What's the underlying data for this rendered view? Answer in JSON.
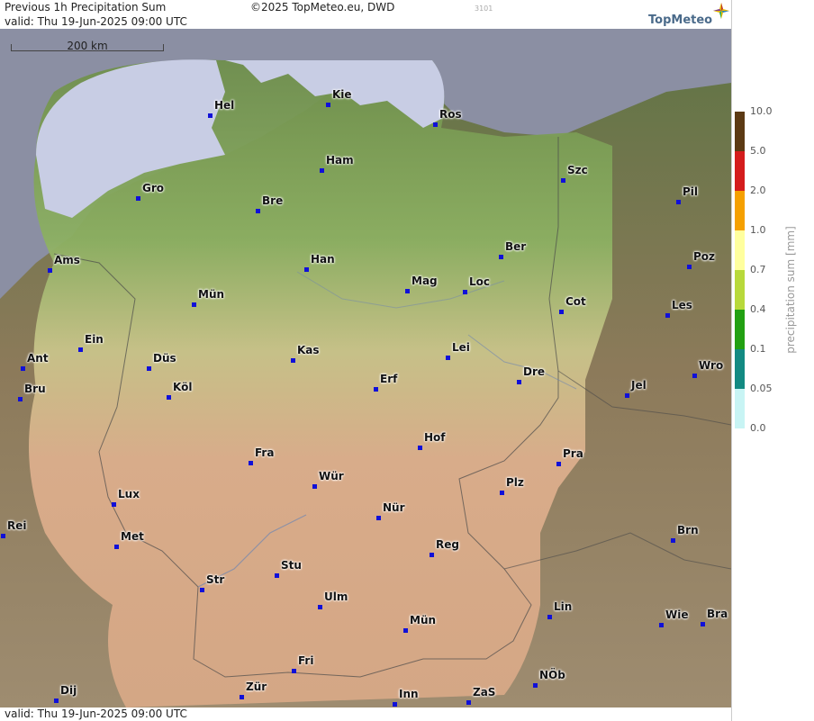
{
  "header": {
    "title": "Previous 1h Precipitation Sum",
    "valid": "valid:  Thu  19-Jun-2025 09:00 UTC",
    "copyright": "©2025 TopMeteo.eu, DWD",
    "run_id": "3101",
    "logo": "TopMeteo"
  },
  "footer": {
    "valid": "valid:  Thu  19-Jun-2025 09:00 UTC"
  },
  "map": {
    "scale_label": "200 km",
    "colors": {
      "sea": "#c8cde4",
      "outside_sea": "#8b8fa3",
      "lowland": "#7aa35a",
      "upland": "#e2b69a"
    },
    "cities": [
      {
        "id": "hel",
        "name": "Hel"
      },
      {
        "id": "kie",
        "name": "Kie"
      },
      {
        "id": "ros",
        "name": "Ros"
      },
      {
        "id": "ham",
        "name": "Ham"
      },
      {
        "id": "szc",
        "name": "Szc"
      },
      {
        "id": "gro",
        "name": "Gro"
      },
      {
        "id": "bre",
        "name": "Bre"
      },
      {
        "id": "pil",
        "name": "Pil"
      },
      {
        "id": "ber",
        "name": "Ber"
      },
      {
        "id": "ams",
        "name": "Ams"
      },
      {
        "id": "han",
        "name": "Han"
      },
      {
        "id": "poz",
        "name": "Poz"
      },
      {
        "id": "mag",
        "name": "Mag"
      },
      {
        "id": "loc",
        "name": "Loc"
      },
      {
        "id": "mun",
        "name": "Mün"
      },
      {
        "id": "cot",
        "name": "Cot"
      },
      {
        "id": "les",
        "name": "Les"
      },
      {
        "id": "ein",
        "name": "Ein"
      },
      {
        "id": "kas",
        "name": "Kas"
      },
      {
        "id": "lei",
        "name": "Lei"
      },
      {
        "id": "ant",
        "name": "Ant"
      },
      {
        "id": "dus",
        "name": "Düs"
      },
      {
        "id": "wro",
        "name": "Wro"
      },
      {
        "id": "dre",
        "name": "Dre"
      },
      {
        "id": "erf",
        "name": "Erf"
      },
      {
        "id": "bru",
        "name": "Bru"
      },
      {
        "id": "kol",
        "name": "Köl"
      },
      {
        "id": "jel",
        "name": "Jel"
      },
      {
        "id": "hof",
        "name": "Hof"
      },
      {
        "id": "fra",
        "name": "Fra"
      },
      {
        "id": "pra",
        "name": "Pra"
      },
      {
        "id": "wur",
        "name": "Wür"
      },
      {
        "id": "plz",
        "name": "Plz"
      },
      {
        "id": "lux",
        "name": "Lux"
      },
      {
        "id": "nur",
        "name": "Nür"
      },
      {
        "id": "rei",
        "name": "Rei"
      },
      {
        "id": "brn",
        "name": "Brn"
      },
      {
        "id": "met",
        "name": "Met"
      },
      {
        "id": "reg",
        "name": "Reg"
      },
      {
        "id": "stu",
        "name": "Stu"
      },
      {
        "id": "str",
        "name": "Str"
      },
      {
        "id": "ulm",
        "name": "Ulm"
      },
      {
        "id": "lin",
        "name": "Lin"
      },
      {
        "id": "wie",
        "name": "Wie"
      },
      {
        "id": "bra",
        "name": "Bra"
      },
      {
        "id": "mue",
        "name": "Mün"
      },
      {
        "id": "fri",
        "name": "Fri"
      },
      {
        "id": "nob",
        "name": "NÖb"
      },
      {
        "id": "dij",
        "name": "Dij"
      },
      {
        "id": "zur",
        "name": "Zür"
      },
      {
        "id": "zas",
        "name": "ZaS"
      },
      {
        "id": "inn",
        "name": "Inn"
      }
    ]
  },
  "legend": {
    "unit": "precipitation sum [mm]",
    "values": [
      "10.0",
      "5.0",
      "2.0",
      "1.0",
      "0.7",
      "0.4",
      "0.1",
      "0.05",
      "0.0"
    ],
    "colors": [
      "#5c3a14",
      "#d41c1c",
      "#f5a000",
      "#ffff9e",
      "#b8d93b",
      "#22a012",
      "#138a82",
      "#c8f4f4"
    ]
  }
}
